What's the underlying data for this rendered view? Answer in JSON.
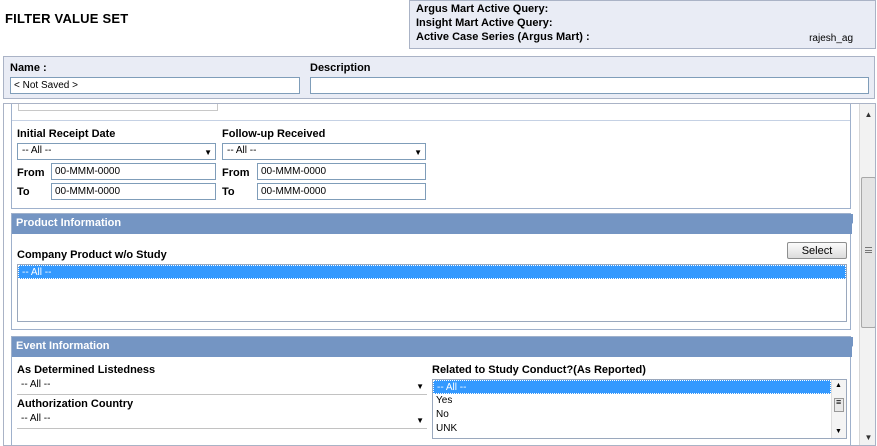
{
  "page_title": "FILTER VALUE SET",
  "query_info": {
    "argus_label": "Argus Mart Active Query:",
    "insight_label": "Insight Mart Active Query:",
    "case_series_label": "Active Case Series (Argus Mart) :",
    "user": "rajesh_ag"
  },
  "name_section": {
    "name_label": "Name :",
    "name_value": "< Not Saved >",
    "description_label": "Description",
    "description_value": ""
  },
  "dates": {
    "initial_receipt_label": "Initial Receipt Date",
    "followup_label": "Follow-up Received",
    "initial_select": "-- All --",
    "followup_select": "-- All --",
    "from_label": "From",
    "to_label": "To",
    "initial_from": "00-MMM-0000",
    "initial_to": "00-MMM-0000",
    "followup_from": "00-MMM-0000",
    "followup_to": "00-MMM-0000"
  },
  "product": {
    "header": "Product Information",
    "company_label": "Company Product w/o Study",
    "select_button": "Select",
    "items": [
      "-- All --"
    ]
  },
  "event": {
    "header": "Event Information",
    "listedness_label": "As Determined Listedness",
    "listedness_value": "-- All --",
    "auth_country_label": "Authorization Country",
    "auth_country_value": "-- All --",
    "related_label": "Related to Study Conduct?(As Reported)",
    "related_options": [
      "-- All --",
      "Yes",
      "No",
      "UNK"
    ]
  },
  "colors": {
    "panel_header": "#7495c3",
    "selection": "#3399ff",
    "info_bg": "#e9ecf5"
  }
}
